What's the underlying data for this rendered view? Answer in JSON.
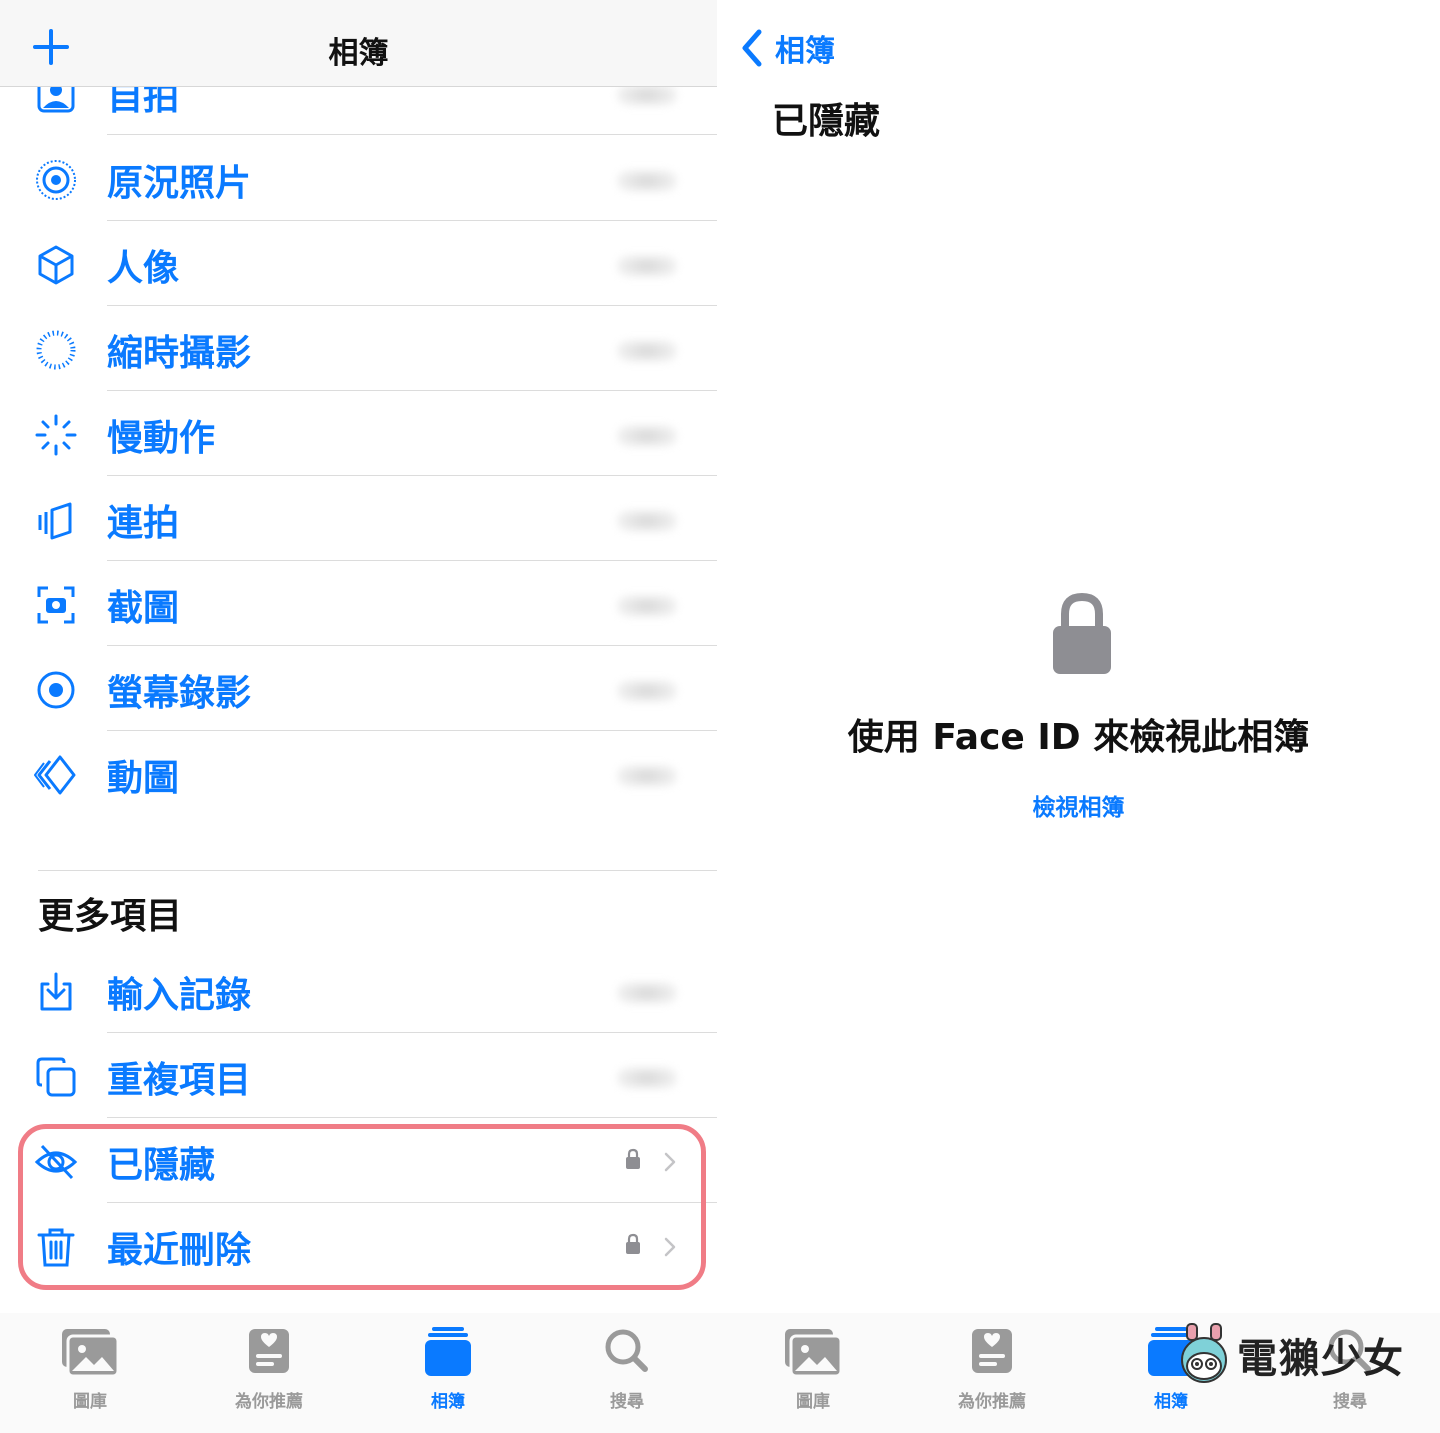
{
  "left": {
    "nav": {
      "title": "相簿",
      "add_icon": "plus-icon"
    },
    "media_types": [
      {
        "label": "自拍",
        "icon": "selfie-icon"
      },
      {
        "label": "原況照片",
        "icon": "live-photo-icon"
      },
      {
        "label": "人像",
        "icon": "cube-icon"
      },
      {
        "label": "縮時攝影",
        "icon": "timelapse-icon"
      },
      {
        "label": "慢動作",
        "icon": "slow-motion-icon"
      },
      {
        "label": "連拍",
        "icon": "burst-icon"
      },
      {
        "label": "截圖",
        "icon": "screenshot-icon"
      },
      {
        "label": "螢幕錄影",
        "icon": "screen-recording-icon"
      },
      {
        "label": "動圖",
        "icon": "animated-icon"
      }
    ],
    "more_section": {
      "title": "更多項目",
      "items": [
        {
          "label": "輸入記錄",
          "icon": "import-icon"
        },
        {
          "label": "重複項目",
          "icon": "duplicates-icon"
        },
        {
          "label": "已隱藏",
          "icon": "eye-slash-icon",
          "locked": true
        },
        {
          "label": "最近刪除",
          "icon": "trash-icon",
          "locked": true
        }
      ]
    },
    "tabbar": [
      {
        "label": "圖庫",
        "icon": "photos-library-icon",
        "active": false
      },
      {
        "label": "為你推薦",
        "icon": "for-you-icon",
        "active": false
      },
      {
        "label": "相簿",
        "icon": "albums-icon",
        "active": true
      },
      {
        "label": "搜尋",
        "icon": "search-icon",
        "active": false
      }
    ]
  },
  "right": {
    "back_label": "相簿",
    "title": "已隱藏",
    "message": "使用 Face ID 來檢視此相簿",
    "action_label": "檢視相簿",
    "tabbar": [
      {
        "label": "圖庫",
        "icon": "photos-library-icon",
        "active": false
      },
      {
        "label": "為你推薦",
        "icon": "for-you-icon",
        "active": false
      },
      {
        "label": "相簿",
        "icon": "albums-icon",
        "active": true
      },
      {
        "label": "搜尋",
        "icon": "search-icon",
        "active": false
      }
    ],
    "watermark": "電獺少女"
  },
  "colors": {
    "accent": "#0a7aff",
    "highlight": "#f07c86",
    "inactive_tab": "#9a9a9a",
    "lock_gray": "#8e8e93"
  }
}
